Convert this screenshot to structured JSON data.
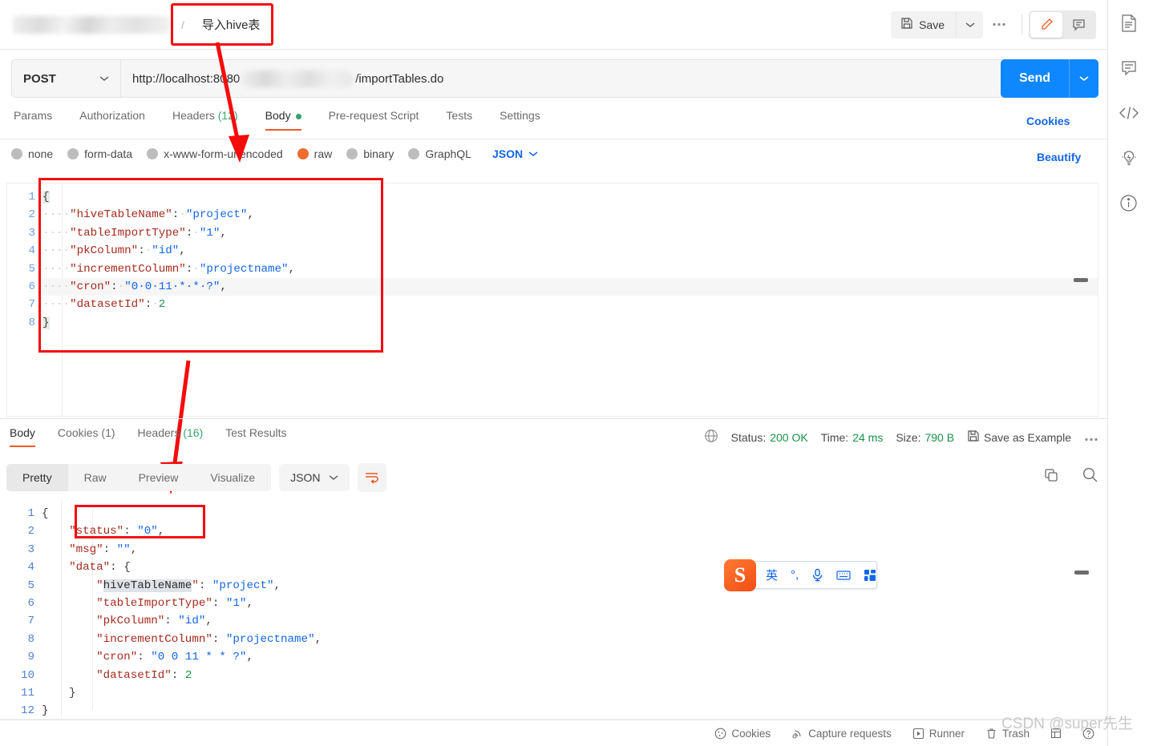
{
  "header": {
    "breadcrumb_separator": "/",
    "collection_name_blurred": "",
    "request_title": "导入hive表",
    "save_label": "Save",
    "save_icon": "floppy-disk-icon",
    "save_caret_icon": "chevron-down-icon",
    "more_icon": "ellipsis-icon",
    "edit_icon": "pencil-icon",
    "comment_icon": "comment-icon"
  },
  "url_bar": {
    "method": "POST",
    "method_caret_icon": "chevron-down-icon",
    "url_prefix": "http://localhost:8080",
    "url_suffix": "/importTables.do",
    "send_label": "Send",
    "send_caret_icon": "chevron-down-icon",
    "send_color": "#0f87ff"
  },
  "request_tabs": {
    "items": [
      {
        "label": "Params",
        "active": false
      },
      {
        "label": "Authorization",
        "active": false
      },
      {
        "label": "Headers",
        "count": "(12)",
        "active": false
      },
      {
        "label": "Body",
        "dot": true,
        "active": true
      },
      {
        "label": "Pre-request Script",
        "active": false
      },
      {
        "label": "Tests",
        "active": false
      },
      {
        "label": "Settings",
        "active": false
      }
    ],
    "cookies_link": "Cookies"
  },
  "body_types": {
    "options": [
      {
        "label": "none",
        "selected": false
      },
      {
        "label": "form-data",
        "selected": false
      },
      {
        "label": "x-www-form-urlencoded",
        "selected": false
      },
      {
        "label": "raw",
        "selected": true
      },
      {
        "label": "binary",
        "selected": false
      },
      {
        "label": "GraphQL",
        "selected": false
      }
    ],
    "format": "JSON",
    "format_caret_icon": "chevron-down-icon",
    "beautify_label": "Beautify",
    "selected_color": "#ef6c2e"
  },
  "request_body": {
    "line_numbers": [
      "1",
      "2",
      "3",
      "4",
      "5",
      "6",
      "7",
      "8"
    ],
    "lines": [
      {
        "tokens": [
          {
            "t": "{",
            "c": "brace"
          }
        ]
      },
      {
        "tokens": [
          {
            "t": "····",
            "c": "ws"
          },
          {
            "t": "\"hiveTableName\"",
            "c": "k"
          },
          {
            "t": ":",
            "c": "p"
          },
          {
            "t": "·",
            "c": "ws"
          },
          {
            "t": "\"project\"",
            "c": "s"
          },
          {
            "t": ",",
            "c": "p"
          }
        ]
      },
      {
        "tokens": [
          {
            "t": "····",
            "c": "ws"
          },
          {
            "t": "\"tableImportType\"",
            "c": "k"
          },
          {
            "t": ":",
            "c": "p"
          },
          {
            "t": "·",
            "c": "ws"
          },
          {
            "t": "\"1\"",
            "c": "s"
          },
          {
            "t": ",",
            "c": "p"
          }
        ]
      },
      {
        "tokens": [
          {
            "t": "····",
            "c": "ws"
          },
          {
            "t": "\"pkColumn\"",
            "c": "k"
          },
          {
            "t": ":",
            "c": "p"
          },
          {
            "t": "·",
            "c": "ws"
          },
          {
            "t": "\"id\"",
            "c": "s"
          },
          {
            "t": ",",
            "c": "p"
          }
        ]
      },
      {
        "tokens": [
          {
            "t": "····",
            "c": "ws"
          },
          {
            "t": "\"incrementColumn\"",
            "c": "k"
          },
          {
            "t": ":",
            "c": "p"
          },
          {
            "t": "·",
            "c": "ws"
          },
          {
            "t": "\"projectname\"",
            "c": "s"
          },
          {
            "t": ",",
            "c": "p"
          }
        ]
      },
      {
        "highlight": true,
        "tokens": [
          {
            "t": "····",
            "c": "ws"
          },
          {
            "t": "\"cron\"",
            "c": "k"
          },
          {
            "t": ":",
            "c": "p"
          },
          {
            "t": "·",
            "c": "ws"
          },
          {
            "t": "\"0·0·11·*·*·?\"",
            "c": "s"
          },
          {
            "t": ",",
            "c": "p"
          }
        ]
      },
      {
        "tokens": [
          {
            "t": "····",
            "c": "ws"
          },
          {
            "t": "\"datasetId\"",
            "c": "k"
          },
          {
            "t": ":",
            "c": "p"
          },
          {
            "t": "·",
            "c": "ws"
          },
          {
            "t": "2",
            "c": "n"
          }
        ]
      },
      {
        "tokens": [
          {
            "t": "}",
            "c": "brace"
          }
        ]
      }
    ]
  },
  "response_tabs": {
    "items": [
      {
        "label": "Body",
        "active": true
      },
      {
        "label": "Cookies",
        "count": "(1)",
        "active": false
      },
      {
        "label": "Headers",
        "count": "(16)",
        "active": false
      },
      {
        "label": "Test Results",
        "active": false
      }
    ]
  },
  "response_meta": {
    "globe_icon": "globe-icon",
    "status_label": "Status:",
    "status_value": "200 OK",
    "time_label": "Time:",
    "time_value": "24 ms",
    "size_label": "Size:",
    "size_value": "790 B",
    "save_example_icon": "floppy-disk-icon",
    "save_example_label": "Save as Example",
    "more_icon": "ellipsis-icon",
    "value_color": "#1a8f4a"
  },
  "response_toolbar": {
    "views": [
      {
        "label": "Pretty",
        "active": true
      },
      {
        "label": "Raw",
        "active": false
      },
      {
        "label": "Preview",
        "active": false
      },
      {
        "label": "Visualize",
        "active": false
      }
    ],
    "format": "JSON",
    "format_caret_icon": "chevron-down-icon",
    "wrap_icon": "wrap-text-icon",
    "copy_icon": "copy-icon",
    "search_icon": "search-icon"
  },
  "response_body": {
    "line_numbers": [
      "1",
      "2",
      "3",
      "4",
      "5",
      "6",
      "7",
      "8",
      "9",
      "10",
      "11",
      "12"
    ],
    "lines": [
      {
        "tokens": [
          {
            "t": "{",
            "c": "p"
          }
        ]
      },
      {
        "tokens": [
          {
            "t": "    ",
            "c": "p"
          },
          {
            "t": "\"status\"",
            "c": "k"
          },
          {
            "t": ": ",
            "c": "p"
          },
          {
            "t": "\"0\"",
            "c": "s"
          },
          {
            "t": ",",
            "c": "p"
          }
        ]
      },
      {
        "tokens": [
          {
            "t": "    ",
            "c": "p"
          },
          {
            "t": "\"msg\"",
            "c": "k"
          },
          {
            "t": ": ",
            "c": "p"
          },
          {
            "t": "\"\"",
            "c": "s"
          },
          {
            "t": ",",
            "c": "p"
          }
        ]
      },
      {
        "tokens": [
          {
            "t": "    ",
            "c": "p"
          },
          {
            "t": "\"data\"",
            "c": "k"
          },
          {
            "t": ": ",
            "c": "p"
          },
          {
            "t": "{",
            "c": "p"
          }
        ]
      },
      {
        "tokens": [
          {
            "t": "        ",
            "c": "p"
          },
          {
            "t": "\"",
            "c": "k"
          },
          {
            "t": "hiveTableName",
            "c": "sel"
          },
          {
            "t": "\"",
            "c": "k"
          },
          {
            "t": ": ",
            "c": "p"
          },
          {
            "t": "\"project\"",
            "c": "s"
          },
          {
            "t": ",",
            "c": "p"
          }
        ]
      },
      {
        "tokens": [
          {
            "t": "        ",
            "c": "p"
          },
          {
            "t": "\"tableImportType\"",
            "c": "k"
          },
          {
            "t": ": ",
            "c": "p"
          },
          {
            "t": "\"1\"",
            "c": "s"
          },
          {
            "t": ",",
            "c": "p"
          }
        ]
      },
      {
        "tokens": [
          {
            "t": "        ",
            "c": "p"
          },
          {
            "t": "\"pkColumn\"",
            "c": "k"
          },
          {
            "t": ": ",
            "c": "p"
          },
          {
            "t": "\"id\"",
            "c": "s"
          },
          {
            "t": ",",
            "c": "p"
          }
        ]
      },
      {
        "tokens": [
          {
            "t": "        ",
            "c": "p"
          },
          {
            "t": "\"incrementColumn\"",
            "c": "k"
          },
          {
            "t": ": ",
            "c": "p"
          },
          {
            "t": "\"projectname\"",
            "c": "s"
          },
          {
            "t": ",",
            "c": "p"
          }
        ]
      },
      {
        "tokens": [
          {
            "t": "        ",
            "c": "p"
          },
          {
            "t": "\"cron\"",
            "c": "k"
          },
          {
            "t": ": ",
            "c": "p"
          },
          {
            "t": "\"0 0 11 * * ?\"",
            "c": "s"
          },
          {
            "t": ",",
            "c": "p"
          }
        ]
      },
      {
        "tokens": [
          {
            "t": "        ",
            "c": "p"
          },
          {
            "t": "\"datasetId\"",
            "c": "k"
          },
          {
            "t": ": ",
            "c": "p"
          },
          {
            "t": "2",
            "c": "n"
          }
        ]
      },
      {
        "tokens": [
          {
            "t": "    }",
            "c": "p"
          }
        ]
      },
      {
        "tokens": [
          {
            "t": "}",
            "c": "p"
          }
        ]
      }
    ]
  },
  "right_rail": {
    "items": [
      {
        "icon": "document-icon"
      },
      {
        "icon": "comment-icon"
      },
      {
        "icon": "code-icon"
      },
      {
        "icon": "lightbulb-icon"
      },
      {
        "icon": "info-icon"
      }
    ]
  },
  "footer": {
    "items": [
      {
        "label": "Cookies",
        "icon": "cookie-icon"
      },
      {
        "label": "Capture requests",
        "icon": "satellite-icon"
      },
      {
        "label": "Runner",
        "icon": "play-box-icon"
      },
      {
        "label": "Trash",
        "icon": "trash-icon"
      },
      {
        "label": "",
        "icon": "expand-icon"
      },
      {
        "label": "",
        "icon": "help-icon"
      }
    ],
    "watermark": "CSDN @super先生"
  },
  "ime": {
    "logo": "S",
    "mode": "英",
    "punctuation": "°,",
    "mic_icon": "microphone-icon",
    "keyboard_icon": "keyboard-icon",
    "apps_icon": "apps-grid-icon"
  },
  "annotations": {
    "color": "#f40c0c",
    "boxes": [
      "request-title-box",
      "request-body-box",
      "response-status-box"
    ],
    "arrows": [
      "title-to-body-type-arrow",
      "body-to-response-arrow"
    ]
  }
}
